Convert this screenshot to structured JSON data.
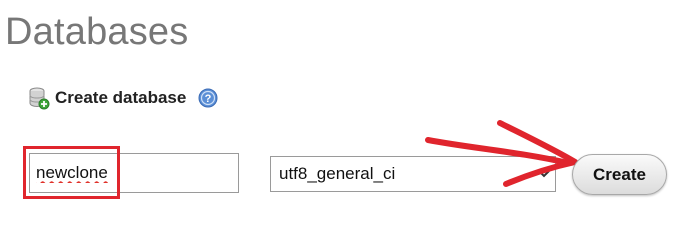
{
  "page": {
    "title": "Databases"
  },
  "create_section": {
    "title": "Create database",
    "icons": {
      "database": "database-add-icon",
      "help": "help-icon"
    }
  },
  "form": {
    "database_name_value": "newclone",
    "collation_selected": "utf8_general_ci",
    "create_label": "Create"
  },
  "annotation": {
    "type": "red-arrow-and-box",
    "color": "#e0252d"
  }
}
